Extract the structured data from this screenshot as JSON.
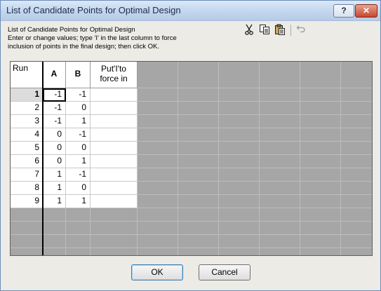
{
  "window": {
    "title": "List of Candidate Points for Optimal Design",
    "help_label": "?",
    "close_label": "✕"
  },
  "instructions": {
    "line1": "List of Candidate Points for Optimal Design",
    "line2": "Enter or change values; type 'I' in the last column to force",
    "line3": "inclusion of points in the final design; then click OK."
  },
  "toolbar": {
    "cut_icon": "scissors-icon",
    "copy_icon": "copy-icon",
    "paste_icon": "paste-icon",
    "undo_icon": "undo-icon"
  },
  "table": {
    "run_header": "Run",
    "col_a": "A",
    "col_b": "B",
    "col_put_line1": "Put'I'to",
    "col_put_line2": "force in",
    "rows": [
      {
        "run": "1",
        "a": "-1",
        "b": "-1",
        "force": ""
      },
      {
        "run": "2",
        "a": "-1",
        "b": "0",
        "force": ""
      },
      {
        "run": "3",
        "a": "-1",
        "b": "1",
        "force": ""
      },
      {
        "run": "4",
        "a": "0",
        "b": "-1",
        "force": ""
      },
      {
        "run": "5",
        "a": "0",
        "b": "0",
        "force": ""
      },
      {
        "run": "6",
        "a": "0",
        "b": "1",
        "force": ""
      },
      {
        "run": "7",
        "a": "1",
        "b": "-1",
        "force": ""
      },
      {
        "run": "8",
        "a": "1",
        "b": "0",
        "force": ""
      },
      {
        "run": "9",
        "a": "1",
        "b": "1",
        "force": ""
      }
    ]
  },
  "buttons": {
    "ok": "OK",
    "cancel": "Cancel"
  }
}
